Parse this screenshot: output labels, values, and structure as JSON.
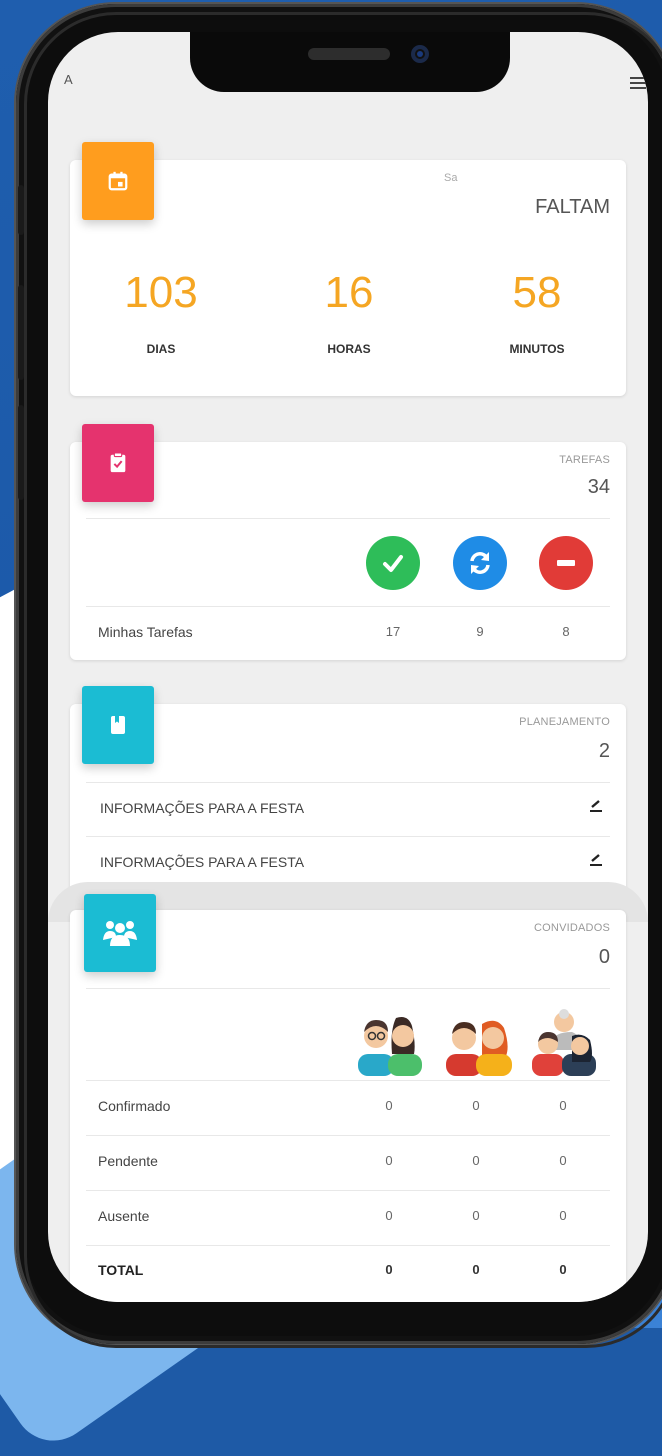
{
  "top_left_text": "A",
  "countdown": {
    "top_text": "Sa",
    "label": "FALTAM",
    "days_value": "103",
    "days_label": "DIAS",
    "hours_value": "16",
    "hours_label": "HORAS",
    "minutes_value": "58",
    "minutes_label": "MINUTOS",
    "icon": "calendar-icon",
    "color": "#ff9d1e"
  },
  "tasks": {
    "label": "TAREFAS",
    "total": "34",
    "row_label": "Minhas Tarefas",
    "done": "17",
    "in_progress": "9",
    "blocked": "8",
    "icon": "clipboard-check-icon",
    "color": "#e5336e"
  },
  "planning": {
    "label": "PLANEJAMENTO",
    "total": "2",
    "items": [
      {
        "label": "INFORMAÇÕES PARA A FESTA"
      },
      {
        "label": "INFORMAÇÕES PARA A FESTA"
      }
    ],
    "icon": "book-icon",
    "color": "#1bbcd3"
  },
  "guests": {
    "label": "CONVIDADOS",
    "total": "0",
    "rows": [
      {
        "label": "Confirmado",
        "a": "0",
        "b": "0",
        "c": "0"
      },
      {
        "label": "Pendente",
        "a": "0",
        "b": "0",
        "c": "0"
      },
      {
        "label": "Ausente",
        "a": "0",
        "b": "0",
        "c": "0"
      }
    ],
    "total_row": {
      "label": "TOTAL",
      "a": "0",
      "b": "0",
      "c": "0"
    },
    "icon": "users-icon",
    "color": "#1bbcd3"
  },
  "colors": {
    "accent_orange": "#f5a623",
    "success": "#2ebd59",
    "info": "#1f8ce6",
    "danger": "#e13b37"
  }
}
